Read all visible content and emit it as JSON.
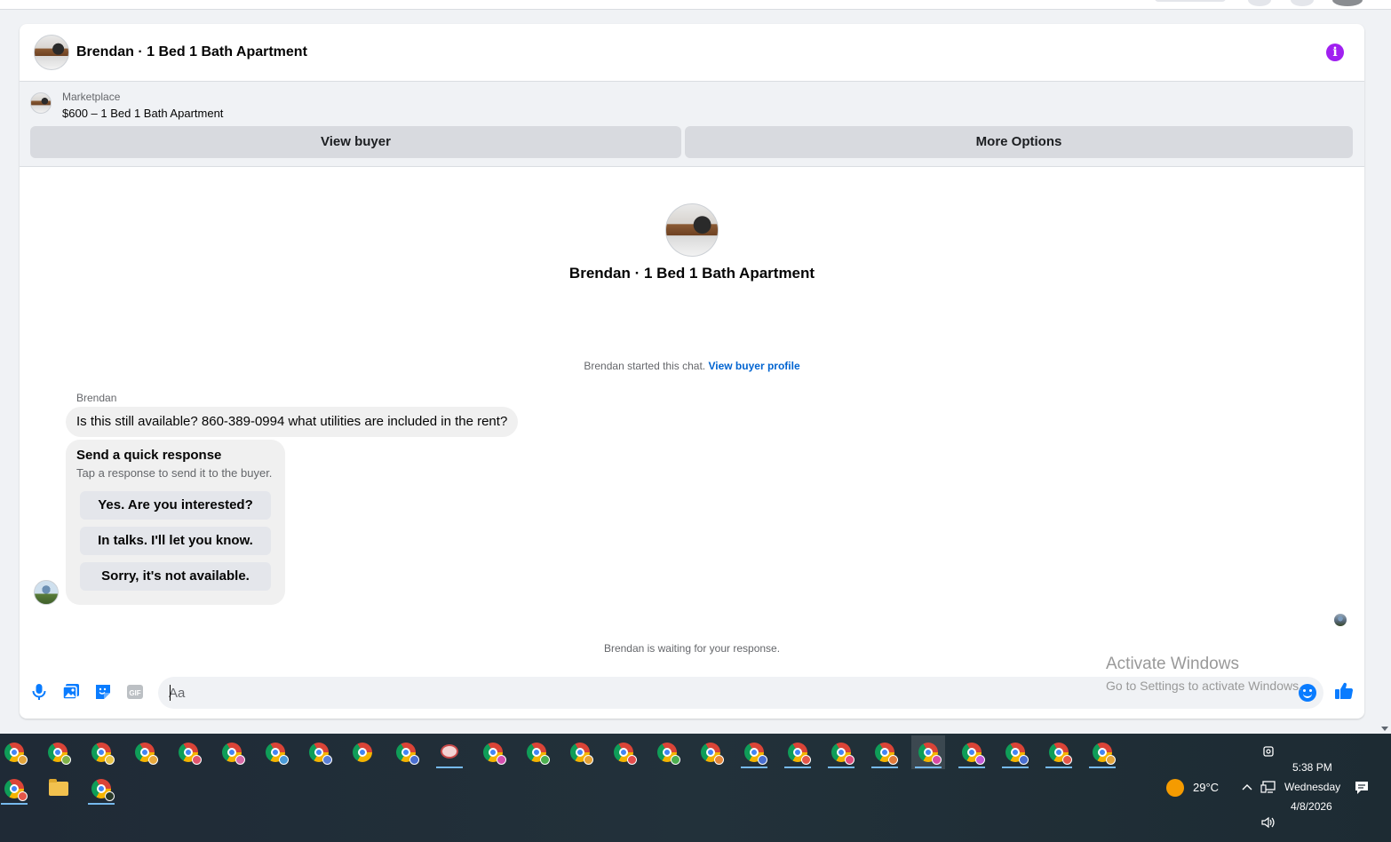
{
  "conversation": {
    "header_title": "Brendan · 1 Bed 1 Bath Apartment",
    "info_icon": "i",
    "marketplace_label": "Marketplace",
    "listing_text": "$600 – 1 Bed 1 Bath Apartment",
    "view_buyer_label": "View buyer",
    "more_options_label": "More Options",
    "center_title": "Brendan · 1 Bed 1 Bath Apartment",
    "started_text": "Brendan started this chat.",
    "view_buyer_profile_link": "View buyer profile",
    "sender_name": "Brendan",
    "message_text": "Is this still available? 860-389-0994 what utilities are included in the rent?",
    "quick_response": {
      "title": "Send a quick response",
      "subtitle": "Tap a response to send it to the buyer.",
      "options": [
        "Yes. Are you interested?",
        "In talks. I'll let you know.",
        "Sorry, it's not available."
      ]
    },
    "waiting_text": "Brendan is waiting for your response.",
    "composer": {
      "placeholder": "Aa",
      "gif_label": "GIF"
    },
    "accent_color": "#0a7cff",
    "info_color": "#a020f0"
  },
  "watermark": {
    "line1": "Activate Windows",
    "line2": "Go to Settings to activate Windows."
  },
  "taskbar": {
    "weather_temp": "29°C",
    "time": "5:38 PM",
    "day": "Wednesday",
    "date": "4/8/2026",
    "row1_apps": [
      {
        "icon": "chrome-icon",
        "badge": "#e2a33a",
        "open": false
      },
      {
        "icon": "chrome-icon",
        "badge": "#7fb24a",
        "open": false
      },
      {
        "icon": "chrome-icon",
        "badge": "#e8c448",
        "open": false
      },
      {
        "icon": "chrome-icon",
        "badge": "#e7a83c",
        "open": false
      },
      {
        "icon": "chrome-icon",
        "badge": "#e0556e",
        "open": false
      },
      {
        "icon": "chrome-icon",
        "badge": "#d86aa8",
        "open": false
      },
      {
        "icon": "chrome-icon",
        "badge": "#4a9bd8",
        "open": false
      },
      {
        "icon": "chrome-icon",
        "badge": "#5b7fd4",
        "open": false
      },
      {
        "icon": "chrome-icon",
        "badge": "",
        "open": false
      },
      {
        "icon": "chrome-icon",
        "badge": "#4a6fd0",
        "open": false
      },
      {
        "icon": "snipping-tool-icon",
        "badge": "",
        "open": true
      },
      {
        "icon": "chrome-icon",
        "badge": "#d44fb0",
        "open": false
      },
      {
        "icon": "chrome-icon",
        "badge": "#4caf50",
        "open": false
      },
      {
        "icon": "chrome-icon",
        "badge": "#e5a236",
        "open": false
      },
      {
        "icon": "chrome-icon",
        "badge": "#e44c4c",
        "open": false
      },
      {
        "icon": "chrome-icon",
        "badge": "#4caf50",
        "open": false
      },
      {
        "icon": "chrome-icon",
        "badge": "#e6883a",
        "open": false
      },
      {
        "icon": "chrome-icon",
        "badge": "#4a6fd0",
        "open": true
      },
      {
        "icon": "chrome-icon",
        "badge": "#e4574a",
        "open": true
      },
      {
        "icon": "chrome-icon",
        "badge": "#e04a7a",
        "open": true
      },
      {
        "icon": "chrome-icon",
        "badge": "#e07a3a",
        "open": true
      },
      {
        "icon": "chrome-icon",
        "badge": "#d84aa4",
        "open": true,
        "active": true
      },
      {
        "icon": "chrome-icon",
        "badge": "#c45ad8",
        "open": true
      },
      {
        "icon": "chrome-icon",
        "badge": "#4a6fd0",
        "open": true
      },
      {
        "icon": "chrome-icon",
        "badge": "#e4574a",
        "open": true
      },
      {
        "icon": "chrome-icon",
        "badge": "#e2a33a",
        "open": true
      }
    ],
    "row2_apps": [
      {
        "icon": "chrome-icon",
        "badge": "#e4574a",
        "open": true
      },
      {
        "icon": "file-explorer-icon",
        "badge": "",
        "open": false
      },
      {
        "icon": "chrome-icon",
        "badge": "#2a3a2a",
        "open": true
      }
    ]
  }
}
